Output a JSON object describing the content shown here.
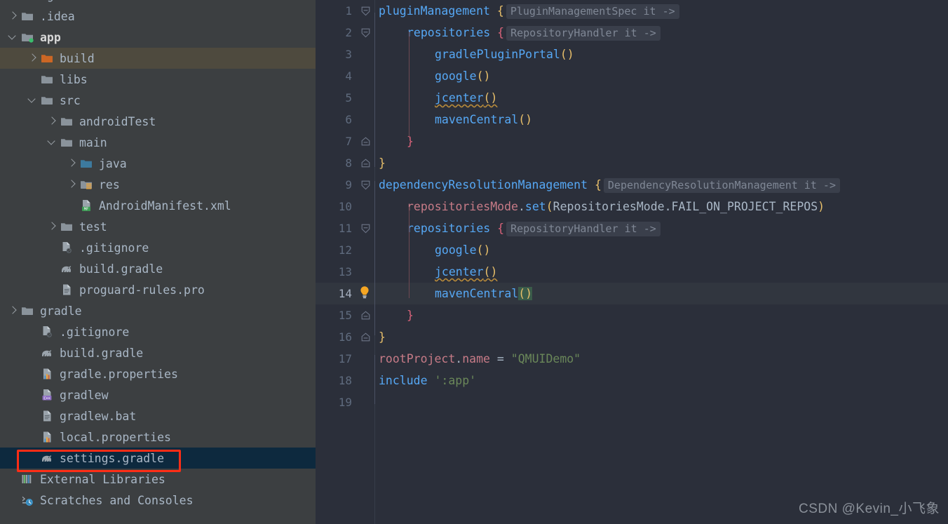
{
  "sidebar": {
    "name": "project-tree",
    "rows": [
      {
        "indent": 0,
        "arrow": "down",
        "icon": "folder-orange",
        "label": ".gradle",
        "state": "clipped",
        "bold": false
      },
      {
        "indent": 0,
        "arrow": "right",
        "icon": "folder-grey",
        "label": ".idea",
        "state": "normal",
        "bold": false
      },
      {
        "indent": 0,
        "arrow": "down",
        "icon": "folder-module",
        "label": "app",
        "state": "normal",
        "bold": true
      },
      {
        "indent": 1,
        "arrow": "right",
        "icon": "folder-orange",
        "label": "build",
        "state": "hovered",
        "bold": false
      },
      {
        "indent": 1,
        "arrow": "none",
        "icon": "folder-grey",
        "label": "libs",
        "state": "normal",
        "bold": false
      },
      {
        "indent": 1,
        "arrow": "down",
        "icon": "folder-grey",
        "label": "src",
        "state": "normal",
        "bold": false
      },
      {
        "indent": 2,
        "arrow": "right",
        "icon": "folder-grey",
        "label": "androidTest",
        "state": "normal",
        "bold": false
      },
      {
        "indent": 2,
        "arrow": "down",
        "icon": "folder-grey",
        "label": "main",
        "state": "normal",
        "bold": false
      },
      {
        "indent": 3,
        "arrow": "right",
        "icon": "folder-blue",
        "label": "java",
        "state": "normal",
        "bold": false
      },
      {
        "indent": 3,
        "arrow": "right",
        "icon": "folder-res",
        "label": "res",
        "state": "normal",
        "bold": false
      },
      {
        "indent": 3,
        "arrow": "none",
        "icon": "file-manifest",
        "label": "AndroidManifest.xml",
        "state": "normal",
        "bold": false
      },
      {
        "indent": 2,
        "arrow": "right",
        "icon": "folder-grey",
        "label": "test",
        "state": "normal",
        "bold": false
      },
      {
        "indent": 2,
        "arrow": "none",
        "icon": "file-gitignore",
        "label": ".gitignore",
        "state": "normal",
        "bold": false
      },
      {
        "indent": 2,
        "arrow": "none",
        "icon": "file-gradle",
        "label": "build.gradle",
        "state": "normal",
        "bold": false
      },
      {
        "indent": 2,
        "arrow": "none",
        "icon": "file-text",
        "label": "proguard-rules.pro",
        "state": "normal",
        "bold": false
      },
      {
        "indent": 0,
        "arrow": "right",
        "icon": "folder-grey",
        "label": "gradle",
        "state": "normal",
        "bold": false
      },
      {
        "indent": 1,
        "arrow": "none",
        "icon": "file-gitignore",
        "label": ".gitignore",
        "state": "normal",
        "bold": false
      },
      {
        "indent": 1,
        "arrow": "none",
        "icon": "file-gradle",
        "label": "build.gradle",
        "state": "normal",
        "bold": false
      },
      {
        "indent": 1,
        "arrow": "none",
        "icon": "file-props",
        "label": "gradle.properties",
        "state": "normal",
        "bold": false
      },
      {
        "indent": 1,
        "arrow": "none",
        "icon": "file-cpp",
        "label": "gradlew",
        "state": "normal",
        "bold": false
      },
      {
        "indent": 1,
        "arrow": "none",
        "icon": "file-text",
        "label": "gradlew.bat",
        "state": "normal",
        "bold": false
      },
      {
        "indent": 1,
        "arrow": "none",
        "icon": "file-props",
        "label": "local.properties",
        "state": "normal",
        "bold": false
      },
      {
        "indent": 1,
        "arrow": "none",
        "icon": "file-gradle",
        "label": "settings.gradle",
        "state": "selected",
        "bold": false
      },
      {
        "indent": 0,
        "arrow": "none",
        "icon": "libraries",
        "label": "External Libraries",
        "state": "normal",
        "bold": false
      },
      {
        "indent": 0,
        "arrow": "none",
        "icon": "scratches",
        "label": "Scratches and Consoles",
        "state": "normal",
        "bold": false
      }
    ]
  },
  "editor": {
    "name": "settings-gradle-editor",
    "current_line": 14,
    "lines": [
      {
        "num": 1,
        "fold": "collapse-top",
        "bulb": false,
        "indent": 0,
        "tokens": [
          {
            "t": "fn",
            "v": "pluginManagement"
          },
          {
            "t": "plain",
            "v": " "
          },
          {
            "t": "brace-y",
            "v": "{"
          }
        ],
        "hint": "PluginManagementSpec it ->"
      },
      {
        "num": 2,
        "fold": "collapse-sub",
        "bulb": false,
        "indent": 1,
        "tokens": [
          {
            "t": "fn",
            "v": "repositories"
          },
          {
            "t": "plain",
            "v": " "
          },
          {
            "t": "brace-r",
            "v": "{"
          }
        ],
        "hint": "RepositoryHandler it ->"
      },
      {
        "num": 3,
        "fold": "none",
        "bulb": false,
        "indent": 2,
        "tokens": [
          {
            "t": "fn",
            "v": "gradlePluginPortal"
          },
          {
            "t": "paren",
            "v": "()"
          }
        ],
        "hint": ""
      },
      {
        "num": 4,
        "fold": "none",
        "bulb": false,
        "indent": 2,
        "tokens": [
          {
            "t": "fn",
            "v": "google"
          },
          {
            "t": "paren",
            "v": "()"
          }
        ],
        "hint": ""
      },
      {
        "num": 5,
        "fold": "none",
        "bulb": false,
        "indent": 2,
        "wavy": true,
        "tokens": [
          {
            "t": "fn",
            "v": "jcenter"
          },
          {
            "t": "paren",
            "v": "()"
          }
        ],
        "hint": ""
      },
      {
        "num": 6,
        "fold": "none",
        "bulb": false,
        "indent": 2,
        "tokens": [
          {
            "t": "fn",
            "v": "mavenCentral"
          },
          {
            "t": "paren",
            "v": "()"
          }
        ],
        "hint": ""
      },
      {
        "num": 7,
        "fold": "end-sub",
        "bulb": false,
        "indent": 1,
        "tokens": [
          {
            "t": "brace-r",
            "v": "}"
          }
        ],
        "hint": ""
      },
      {
        "num": 8,
        "fold": "end-top",
        "bulb": false,
        "indent": 0,
        "tokens": [
          {
            "t": "brace-y",
            "v": "}"
          }
        ],
        "hint": ""
      },
      {
        "num": 9,
        "fold": "collapse-top",
        "bulb": false,
        "indent": 0,
        "tokens": [
          {
            "t": "fn",
            "v": "dependencyResolutionManagement"
          },
          {
            "t": "plain",
            "v": " "
          },
          {
            "t": "brace-y",
            "v": "{"
          }
        ],
        "hint": "DependencyResolutionManagement it ->"
      },
      {
        "num": 10,
        "fold": "none",
        "bulb": false,
        "indent": 1,
        "tokens": [
          {
            "t": "prop",
            "v": "repositoriesMode"
          },
          {
            "t": "dot",
            "v": "."
          },
          {
            "t": "fn",
            "v": "set"
          },
          {
            "t": "paren",
            "v": "("
          },
          {
            "t": "id",
            "v": "RepositoriesMode.FAIL_ON_PROJECT_REPOS"
          },
          {
            "t": "paren",
            "v": ")"
          }
        ],
        "hint": ""
      },
      {
        "num": 11,
        "fold": "collapse-sub",
        "bulb": false,
        "indent": 1,
        "tokens": [
          {
            "t": "fn",
            "v": "repositories"
          },
          {
            "t": "plain",
            "v": " "
          },
          {
            "t": "brace-r",
            "v": "{"
          }
        ],
        "hint": "RepositoryHandler it ->"
      },
      {
        "num": 12,
        "fold": "none",
        "bulb": false,
        "indent": 2,
        "tokens": [
          {
            "t": "fn",
            "v": "google"
          },
          {
            "t": "paren",
            "v": "()"
          }
        ],
        "hint": ""
      },
      {
        "num": 13,
        "fold": "none",
        "bulb": false,
        "indent": 2,
        "wavy": true,
        "tokens": [
          {
            "t": "fn",
            "v": "jcenter"
          },
          {
            "t": "paren",
            "v": "()"
          }
        ],
        "hint": ""
      },
      {
        "num": 14,
        "fold": "none",
        "bulb": true,
        "indent": 2,
        "bracket": true,
        "tokens": [
          {
            "t": "fn",
            "v": "mavenCentral"
          },
          {
            "t": "paren-hl",
            "v": "()"
          }
        ],
        "hint": ""
      },
      {
        "num": 15,
        "fold": "end-sub",
        "bulb": false,
        "indent": 1,
        "tokens": [
          {
            "t": "brace-r",
            "v": "}"
          }
        ],
        "hint": ""
      },
      {
        "num": 16,
        "fold": "end-top",
        "bulb": false,
        "indent": 0,
        "tokens": [
          {
            "t": "brace-y",
            "v": "}"
          }
        ],
        "hint": ""
      },
      {
        "num": 17,
        "fold": "none",
        "bulb": false,
        "indent": 0,
        "tokens": [
          {
            "t": "prop",
            "v": "rootProject"
          },
          {
            "t": "dot",
            "v": "."
          },
          {
            "t": "prop",
            "v": "name"
          },
          {
            "t": "plain",
            "v": " = "
          },
          {
            "t": "str",
            "v": "\"QMUIDemo\""
          }
        ],
        "hint": ""
      },
      {
        "num": 18,
        "fold": "none",
        "bulb": false,
        "indent": 0,
        "tokens": [
          {
            "t": "kw",
            "v": "include"
          },
          {
            "t": "plain",
            "v": " "
          },
          {
            "t": "str",
            "v": "':app'"
          }
        ],
        "hint": ""
      },
      {
        "num": 19,
        "fold": "none",
        "bulb": false,
        "indent": 0,
        "tokens": [],
        "hint": ""
      }
    ]
  },
  "watermark": {
    "text": "CSDN @Kevin_小飞象"
  },
  "colors": {
    "sidebar_bg": "#3c3f41",
    "editor_bg": "#2b2f3a",
    "selection_bg": "#0d293e",
    "hover_bg": "#4e4a3e",
    "annotation": "#ff2d16",
    "fn_blue": "#56a8f5",
    "brace_yellow": "#e8bf6a",
    "brace_red": "#d9637a",
    "string_green": "#6a8759",
    "prop_pink": "#c77b87"
  }
}
